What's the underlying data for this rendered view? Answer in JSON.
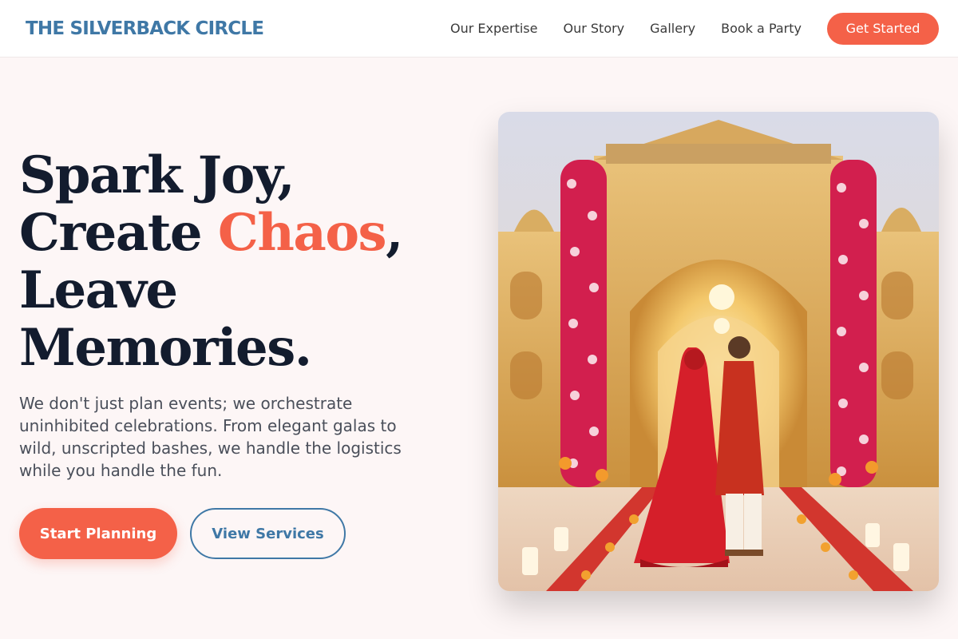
{
  "header": {
    "brand": "THE SILVERBACK CIRCLE",
    "nav": [
      {
        "label": "Our Expertise"
      },
      {
        "label": "Our Story"
      },
      {
        "label": "Gallery"
      },
      {
        "label": "Book a Party"
      }
    ],
    "cta_label": "Get Started"
  },
  "hero": {
    "title_line1": "Spark Joy,",
    "title_line2_pre": "Create ",
    "title_line2_accent": "Chaos",
    "title_line2_post": ",",
    "title_line3": "Leave",
    "title_line4": "Memories.",
    "subtitle": "We don't just plan events; we orchestrate uninhibited celebrations. From elegant galas to wild, unscripted bashes, we handle the logistics while you handle the fun.",
    "primary_button": "Start Planning",
    "secondary_button": "View Services"
  },
  "colors": {
    "brand": "#3f78a6",
    "accent": "#f46148",
    "background": "#fdf6f6",
    "heading": "#131c2e"
  }
}
